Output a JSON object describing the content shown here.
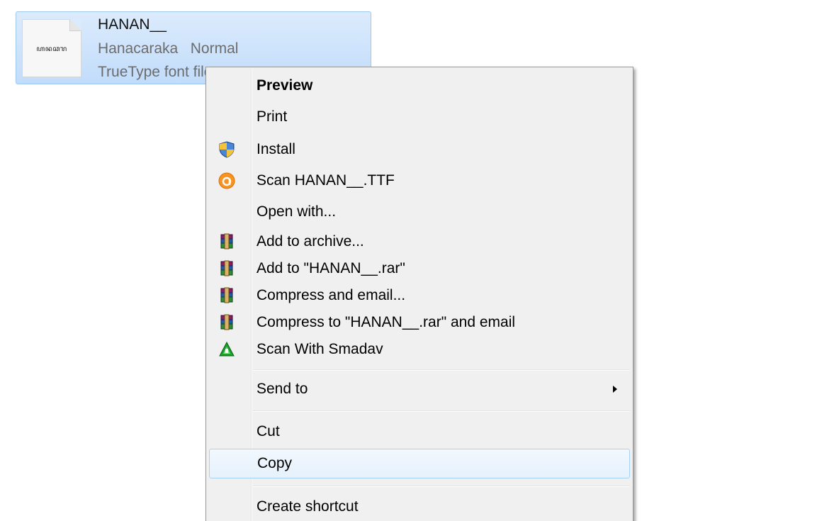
{
  "file": {
    "name": "HANAN__",
    "thumbnail_text": "ꦲꦤꦕꦫ",
    "font_family_line": "Hanacaraka   Normal",
    "type_line": "TrueType font file"
  },
  "context_menu": {
    "items": [
      {
        "label": "Preview",
        "bold": true,
        "icon": null
      },
      {
        "label": "Print",
        "icon": null
      },
      {
        "label": "Install",
        "icon": "uac-shield-icon"
      },
      {
        "label": "Scan HANAN__.TTF",
        "icon": "avast-scan-icon"
      },
      {
        "label": "Open with...",
        "icon": null
      },
      {
        "label": "Add to archive...",
        "icon": "winrar-icon"
      },
      {
        "label": "Add to \"HANAN__.rar\"",
        "icon": "winrar-icon"
      },
      {
        "label": "Compress and email...",
        "icon": "winrar-icon"
      },
      {
        "label": "Compress to \"HANAN__.rar\" and email",
        "icon": "winrar-icon"
      },
      {
        "label": "Scan With Smadav",
        "icon": "smadav-icon"
      },
      {
        "label": "Send to",
        "icon": null,
        "submenu": true
      },
      {
        "label": "Cut",
        "icon": null
      },
      {
        "label": "Copy",
        "icon": null,
        "highlighted": true
      },
      {
        "label": "Create shortcut",
        "icon": null
      }
    ]
  },
  "colors": {
    "selection_fill": "#c9e1fb",
    "selection_border": "#9ec8ef",
    "menu_background": "#f0f0f0",
    "menu_hover_border": "#a8d2f5",
    "avast_orange": "#f7931e",
    "smadav_green": "#1aa32a"
  }
}
